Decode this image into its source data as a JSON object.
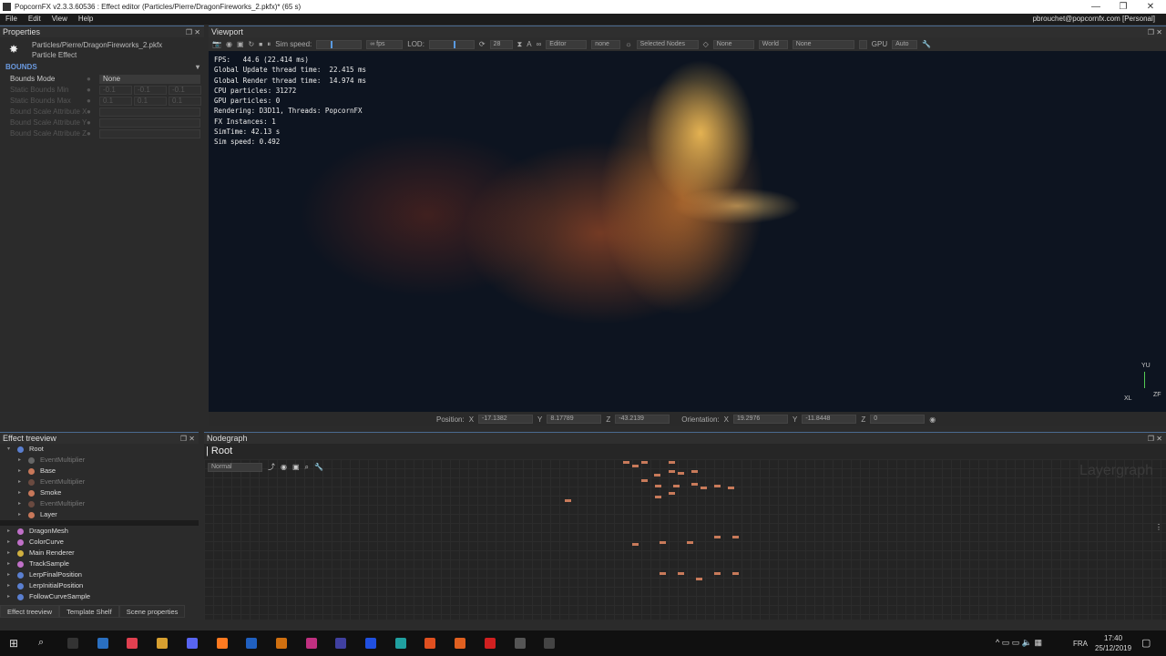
{
  "window": {
    "title": "PopcornFX v2.3.3.60536  : Effect editor (Particles/Pierre/DragonFireworks_2.pkfx)* (65 s)",
    "user": "pbrouchet@popcornfx.com [Personal]",
    "minimize": "—",
    "maximize": "❐",
    "close": "✕"
  },
  "menu": [
    "File",
    "Edit",
    "View",
    "Help"
  ],
  "properties": {
    "title": "Properties",
    "path": "Particles/Pierre/DragonFireworks_2.pkfx",
    "type": "Particle Effect",
    "section": "BOUNDS",
    "rows": [
      {
        "label": "Bounds Mode",
        "values": [
          "None"
        ]
      },
      {
        "label": "Static Bounds Min",
        "values": [
          "-0.1",
          "-0.1",
          "-0.1"
        ]
      },
      {
        "label": "Static Bounds Max",
        "values": [
          "0.1",
          "0.1",
          "0.1"
        ]
      },
      {
        "label": "Bound Scale Attribute X",
        "values": [
          ""
        ]
      },
      {
        "label": "Bound Scale Attribute Y",
        "values": [
          ""
        ]
      },
      {
        "label": "Bound Scale Attribute Z",
        "values": [
          ""
        ]
      }
    ]
  },
  "viewport": {
    "title": "Viewport",
    "sim_speed_label": "Sim speed:",
    "sim_speed_fraction": 0.3,
    "fps_select": "∞ fps",
    "lod_label": "LOD:",
    "lod_fraction": 0.55,
    "lod_value": "28",
    "camera_mode": "Editor",
    "none1": "none",
    "selection": "Selected Nodes",
    "none2": "None",
    "space": "World",
    "none3": "None",
    "gpu_label": "GPU",
    "gpu_mode": "Auto",
    "stats": [
      "FPS:   44.6 (22.414 ms)",
      "Global Update thread time:  22.415 ms",
      "Global Render thread time:  14.974 ms",
      "CPU particles: 31272",
      "GPU particles: 0",
      "Rendering: D3D11, Threads: PopcornFX",
      "FX Instances: 1",
      "SimTime: 42.13 s",
      "Sim speed: 0.492"
    ],
    "position_label": "Position:",
    "orientation_label": "Orientation:",
    "position": {
      "x": "-17.1382",
      "y": "8.17789",
      "z": "-43.2139"
    },
    "orientation": {
      "x": "19.2976",
      "y": "-11.8448",
      "z": "0"
    },
    "axis": {
      "y": "YU",
      "x": "XL",
      "z": "ZF"
    }
  },
  "treeview": {
    "title": "Effect treeview",
    "items": [
      {
        "label": "Root",
        "depth": 0,
        "color": "#5a7fd0",
        "dim": false
      },
      {
        "label": "EventMultiplier",
        "depth": 1,
        "color": "#666",
        "dim": true
      },
      {
        "label": "Base",
        "depth": 1,
        "color": "#c8785a",
        "dim": false
      },
      {
        "label": "EventMultiplier",
        "depth": 1,
        "color": "#6a4a40",
        "dim": true
      },
      {
        "label": "Smoke",
        "depth": 1,
        "color": "#c8785a",
        "dim": false
      },
      {
        "label": "EventMultiplier",
        "depth": 1,
        "color": "#6a4a40",
        "dim": true
      },
      {
        "label": "Layer",
        "depth": 1,
        "color": "#c8785a",
        "dim": false
      }
    ],
    "templates": [
      {
        "label": "DragonMesh",
        "color": "#c070c8"
      },
      {
        "label": "ColorCurve",
        "color": "#c070c8"
      },
      {
        "label": "Main Renderer",
        "color": "#d0b040"
      },
      {
        "label": "TrackSample",
        "color": "#c070c8"
      },
      {
        "label": "LerpFinalPosition",
        "color": "#5a7fd0"
      },
      {
        "label": "LerpInitialPosition",
        "color": "#5a7fd0"
      },
      {
        "label": "FollowCurveSample",
        "color": "#5a7fd0"
      }
    ],
    "tabs": [
      "Effect treeview",
      "Template Shelf",
      "Scene properties"
    ]
  },
  "nodegraph": {
    "title": "Nodegraph",
    "breadcrumb": "Root",
    "mode": "Normal",
    "watermark": "Layergraph"
  },
  "taskbar": {
    "lang": "FRA",
    "time": "17:40",
    "date": "25/12/2019"
  }
}
